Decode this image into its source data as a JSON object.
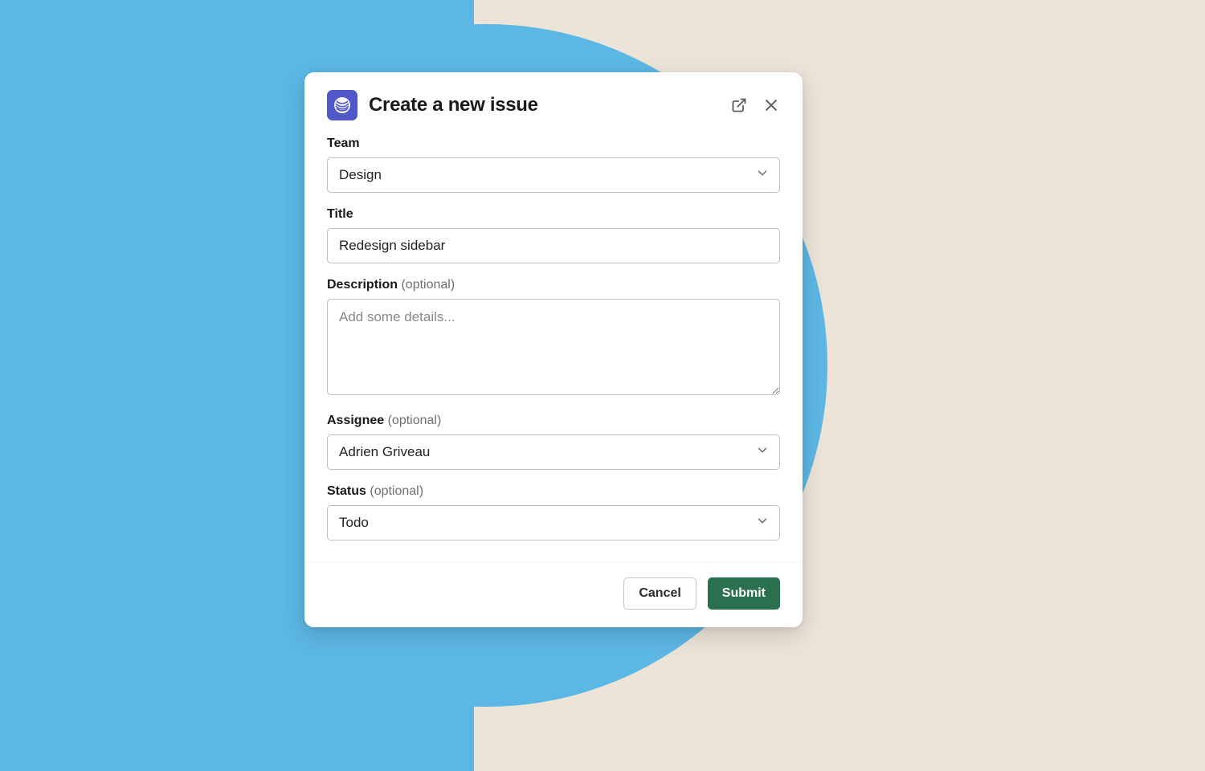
{
  "modal": {
    "title": "Create a new issue",
    "fields": {
      "team": {
        "label": "Team",
        "value": "Design"
      },
      "title": {
        "label": "Title",
        "value": "Redesign sidebar"
      },
      "description": {
        "label": "Description",
        "optional": "(optional)",
        "placeholder": "Add some details..."
      },
      "assignee": {
        "label": "Assignee",
        "optional": "(optional)",
        "value": "Adrien Griveau"
      },
      "status": {
        "label": "Status",
        "optional": "(optional)",
        "value": "Todo"
      }
    },
    "buttons": {
      "cancel": "Cancel",
      "submit": "Submit"
    }
  }
}
